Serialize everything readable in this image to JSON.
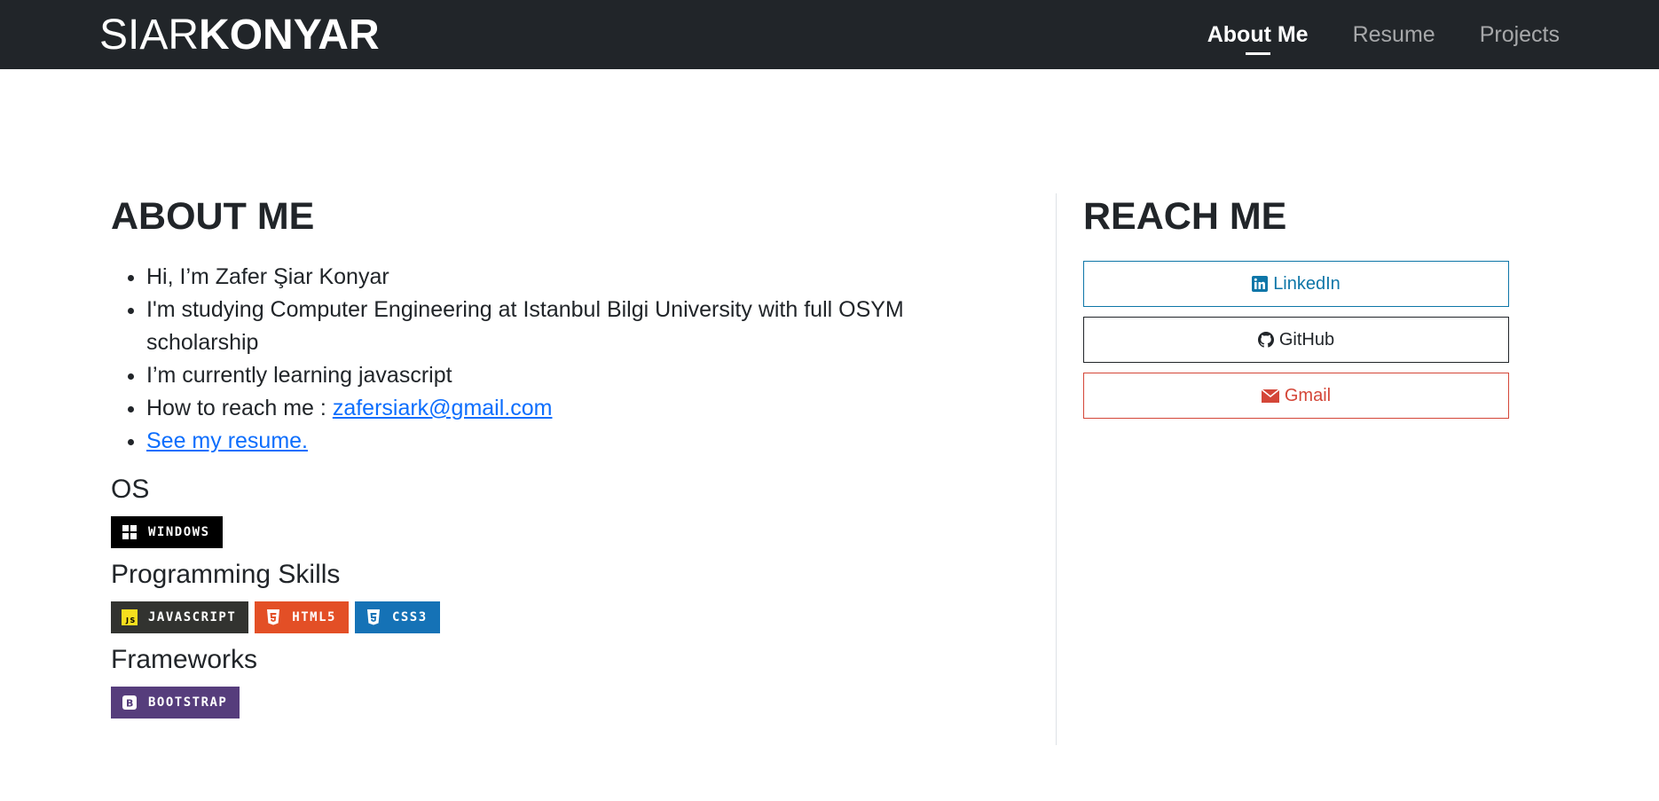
{
  "navbar": {
    "brand_thin": "SIAR",
    "brand_bold": "KONYAR",
    "links": [
      {
        "label": "About Me",
        "active": true
      },
      {
        "label": "Resume",
        "active": false
      },
      {
        "label": "Projects",
        "active": false
      }
    ]
  },
  "about": {
    "title": "ABOUT ME",
    "items": {
      "greeting": "Hi, I’m Zafer Şiar Konyar",
      "study": "I'm studying Computer Engineering at Istanbul Bilgi University with full OSYM scholarship",
      "learning": "I’m currently learning javascript",
      "reach_prefix": "How to reach me : ",
      "email": "zafersiark@gmail.com",
      "resume_link": "See my resume."
    },
    "sections": {
      "os": {
        "title": "OS",
        "badges": [
          {
            "label": "WINDOWS",
            "color": "#000000",
            "icon": "windows-icon"
          }
        ]
      },
      "programming": {
        "title": "Programming Skills",
        "badges": [
          {
            "label": "JAVASCRIPT",
            "color": "#323330",
            "icon": "javascript-icon"
          },
          {
            "label": "HTML5",
            "color": "#e34f26",
            "icon": "html5-icon"
          },
          {
            "label": "CSS3",
            "color": "#1572b6",
            "icon": "css3-icon"
          }
        ]
      },
      "frameworks": {
        "title": "Frameworks",
        "badges": [
          {
            "label": "BOOTSTRAP",
            "color": "#563d7c",
            "icon": "bootstrap-icon"
          }
        ]
      }
    }
  },
  "reach": {
    "title": "REACH ME",
    "buttons": {
      "linkedin": {
        "label": "LinkedIn",
        "color": "#0e76a8",
        "icon": "linkedin-icon"
      },
      "github": {
        "label": "GitHub",
        "color": "#212529",
        "icon": "github-icon"
      },
      "gmail": {
        "label": "Gmail",
        "color": "#d44638",
        "icon": "mail-icon"
      }
    }
  }
}
